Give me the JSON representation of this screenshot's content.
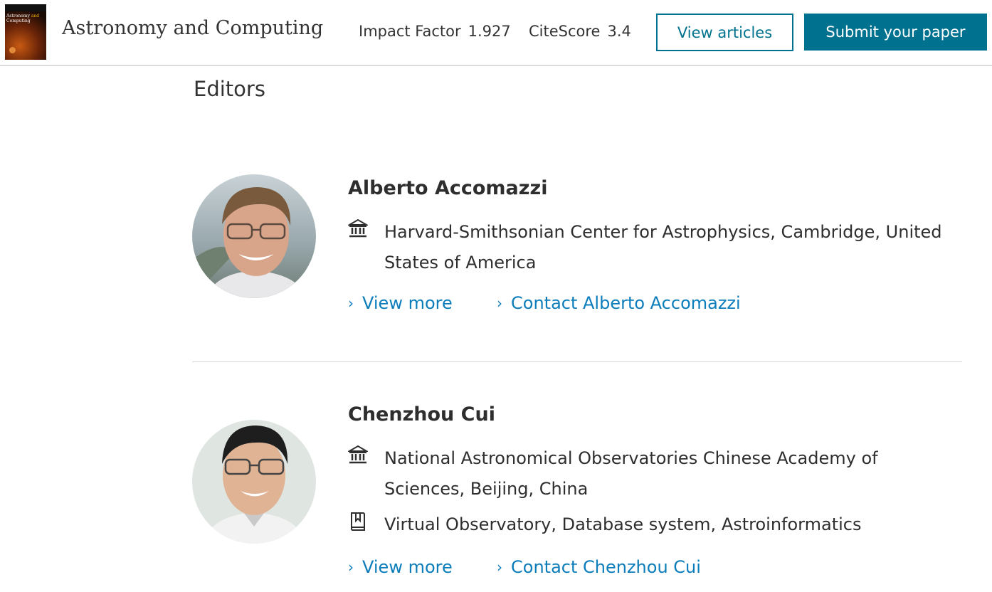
{
  "header": {
    "cover": {
      "title_part1": "Astronomy",
      "title_and": "and",
      "title_part2": "Computing"
    },
    "journal_title": "Astronomy and Computing",
    "impact_factor_label": "Impact Factor",
    "impact_factor_value": "1.927",
    "citescore_label": "CiteScore",
    "citescore_value": "3.4",
    "view_articles_label": "View articles",
    "submit_label": "Submit your paper"
  },
  "section_title": "Editors",
  "editors": [
    {
      "name": "Alberto Accomazzi",
      "affiliation": "Harvard-Smithsonian Center for Astrophysics, Cambridge, United States of America",
      "view_more": "View more",
      "contact": "Contact Alberto Accomazzi"
    },
    {
      "name": "Chenzhou Cui",
      "affiliation": "National Astronomical Observatories Chinese Academy of Sciences, Beijing, China",
      "interests": "Virtual Observatory, Database system, Astroinformatics",
      "view_more": "View more",
      "contact": "Contact Chenzhou Cui"
    }
  ],
  "icons": {
    "affiliation": "institution-icon",
    "interests": "bookmark-icon",
    "link": "chevron-right-icon"
  },
  "colors": {
    "brand": "#00728f",
    "link": "#0c7dbb",
    "text": "#2e2e2e"
  }
}
